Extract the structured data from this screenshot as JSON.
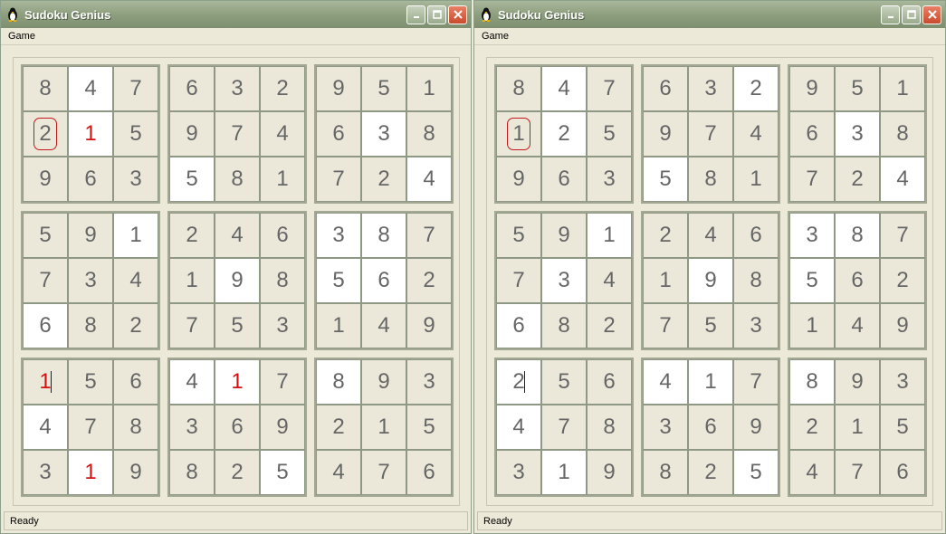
{
  "windows": [
    {
      "title": "Sudoku Genius",
      "menu": [
        "Game"
      ],
      "status": "Ready",
      "selected": [
        1,
        0
      ],
      "caret": [
        6,
        0
      ],
      "cells": [
        [
          8,
          4,
          7,
          6,
          3,
          2,
          9,
          5,
          1
        ],
        [
          2,
          1,
          5,
          9,
          7,
          4,
          6,
          3,
          8
        ],
        [
          9,
          6,
          3,
          5,
          8,
          1,
          7,
          2,
          4
        ],
        [
          5,
          9,
          1,
          2,
          4,
          6,
          3,
          8,
          7
        ],
        [
          7,
          3,
          4,
          1,
          9,
          8,
          5,
          6,
          2
        ],
        [
          6,
          8,
          2,
          7,
          5,
          3,
          1,
          4,
          9
        ],
        [
          1,
          5,
          6,
          4,
          1,
          7,
          8,
          9,
          3
        ],
        [
          4,
          7,
          8,
          3,
          6,
          9,
          2,
          1,
          5
        ],
        [
          3,
          1,
          9,
          8,
          2,
          5,
          4,
          7,
          6
        ]
      ],
      "white": [
        [
          0,
          1,
          0,
          0,
          0,
          0,
          0,
          0,
          0
        ],
        [
          0,
          1,
          0,
          0,
          0,
          0,
          0,
          1,
          0
        ],
        [
          0,
          0,
          0,
          1,
          0,
          0,
          0,
          0,
          1
        ],
        [
          0,
          0,
          1,
          0,
          0,
          0,
          1,
          1,
          0
        ],
        [
          0,
          0,
          0,
          0,
          1,
          0,
          1,
          1,
          0
        ],
        [
          1,
          0,
          0,
          0,
          0,
          0,
          0,
          0,
          0
        ],
        [
          0,
          0,
          0,
          1,
          1,
          0,
          1,
          0,
          0
        ],
        [
          1,
          0,
          0,
          0,
          0,
          0,
          0,
          0,
          0
        ],
        [
          0,
          1,
          0,
          0,
          0,
          1,
          0,
          0,
          0
        ]
      ],
      "errors": [
        [
          1,
          1
        ],
        [
          6,
          0
        ],
        [
          6,
          4
        ],
        [
          8,
          1
        ]
      ]
    },
    {
      "title": "Sudoku Genius",
      "menu": [
        "Game"
      ],
      "status": "Ready",
      "selected": [
        1,
        0
      ],
      "caret": [
        6,
        0
      ],
      "cells": [
        [
          8,
          4,
          7,
          6,
          3,
          2,
          9,
          5,
          1
        ],
        [
          1,
          2,
          5,
          9,
          7,
          4,
          6,
          3,
          8
        ],
        [
          9,
          6,
          3,
          5,
          8,
          1,
          7,
          2,
          4
        ],
        [
          5,
          9,
          1,
          2,
          4,
          6,
          3,
          8,
          7
        ],
        [
          7,
          3,
          4,
          1,
          9,
          8,
          5,
          6,
          2
        ],
        [
          6,
          8,
          2,
          7,
          5,
          3,
          1,
          4,
          9
        ],
        [
          2,
          5,
          6,
          4,
          1,
          7,
          8,
          9,
          3
        ],
        [
          4,
          7,
          8,
          3,
          6,
          9,
          2,
          1,
          5
        ],
        [
          3,
          1,
          9,
          8,
          2,
          5,
          4,
          7,
          6
        ]
      ],
      "white": [
        [
          0,
          1,
          0,
          0,
          0,
          1,
          0,
          0,
          0
        ],
        [
          0,
          1,
          0,
          0,
          0,
          0,
          0,
          1,
          0
        ],
        [
          0,
          0,
          0,
          1,
          0,
          0,
          0,
          0,
          1
        ],
        [
          0,
          0,
          1,
          0,
          0,
          0,
          1,
          1,
          0
        ],
        [
          0,
          1,
          0,
          0,
          1,
          0,
          1,
          0,
          0
        ],
        [
          1,
          0,
          0,
          0,
          0,
          0,
          0,
          0,
          0
        ],
        [
          1,
          0,
          0,
          1,
          1,
          0,
          1,
          0,
          0
        ],
        [
          1,
          0,
          0,
          0,
          0,
          0,
          0,
          0,
          0
        ],
        [
          0,
          1,
          0,
          0,
          0,
          1,
          0,
          0,
          0
        ]
      ],
      "errors": []
    }
  ]
}
